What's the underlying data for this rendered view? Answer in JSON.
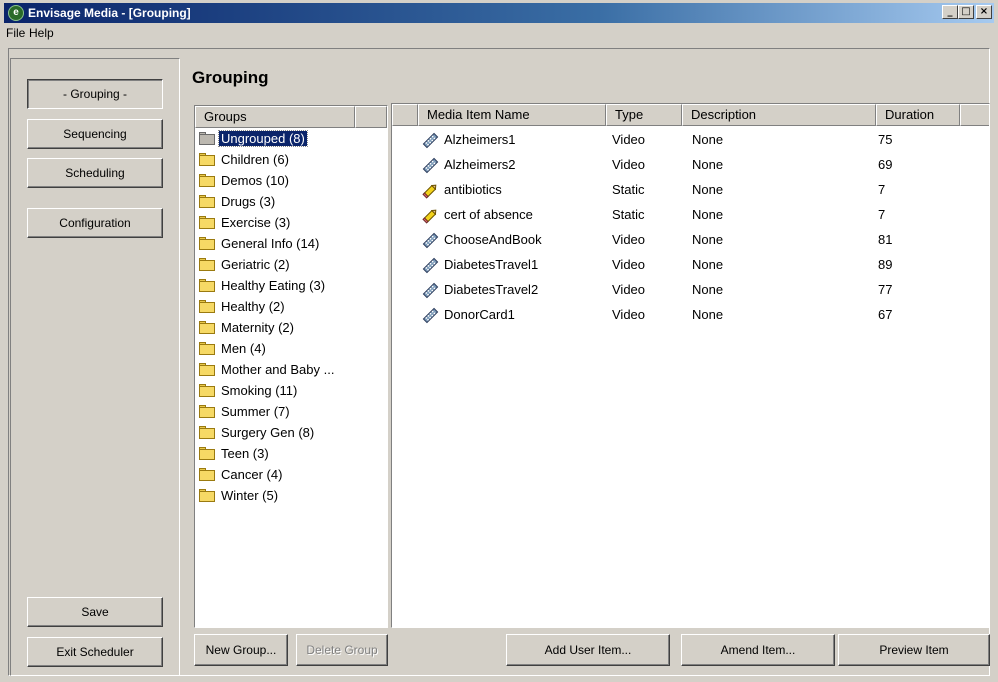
{
  "window": {
    "title": "Envisage Media - [Grouping]",
    "buttons": [
      "_",
      "□",
      "×"
    ]
  },
  "menu": [
    "File",
    "Help"
  ],
  "sidebar": {
    "nav": [
      {
        "label": "- Grouping -",
        "active": true
      },
      {
        "label": "Sequencing"
      },
      {
        "label": "Scheduling"
      },
      {
        "label": "Configuration"
      }
    ],
    "save_label": "Save",
    "exit_label": "Exit Scheduler"
  },
  "page": {
    "title": "Grouping"
  },
  "groups": {
    "header": "Groups",
    "items": [
      {
        "label": "Ungrouped (8)",
        "selected": true
      },
      {
        "label": "Children (6)"
      },
      {
        "label": "Demos (10)"
      },
      {
        "label": "Drugs (3)"
      },
      {
        "label": "Exercise (3)"
      },
      {
        "label": "General Info (14)"
      },
      {
        "label": "Geriatric (2)"
      },
      {
        "label": "Healthy Eating (3)"
      },
      {
        "label": "Healthy (2)"
      },
      {
        "label": "Maternity (2)"
      },
      {
        "label": "Men (4)"
      },
      {
        "label": "Mother and Baby ..."
      },
      {
        "label": "Smoking (11)"
      },
      {
        "label": "Summer (7)"
      },
      {
        "label": "Surgery Gen (8)"
      },
      {
        "label": "Teen (3)"
      },
      {
        "label": "Cancer (4)"
      },
      {
        "label": "Winter (5)"
      }
    ],
    "new_label": "New Group...",
    "delete_label": "Delete Group"
  },
  "media": {
    "columns": [
      "Media Item Name",
      "Type",
      "Description",
      "Duration"
    ],
    "rows": [
      {
        "icon": "video-icon",
        "name": "Alzheimers1",
        "type": "Video",
        "description": "None",
        "duration": "75"
      },
      {
        "icon": "video-icon",
        "name": "Alzheimers2",
        "type": "Video",
        "description": "None",
        "duration": "69"
      },
      {
        "icon": "static-icon",
        "name": "antibiotics",
        "type": "Static",
        "description": "None",
        "duration": "7"
      },
      {
        "icon": "static-icon",
        "name": "cert of absence",
        "type": "Static",
        "description": "None",
        "duration": "7"
      },
      {
        "icon": "video-icon",
        "name": "ChooseAndBook",
        "type": "Video",
        "description": "None",
        "duration": "81"
      },
      {
        "icon": "video-icon",
        "name": "DiabetesTravel1",
        "type": "Video",
        "description": "None",
        "duration": "89"
      },
      {
        "icon": "video-icon",
        "name": "DiabetesTravel2",
        "type": "Video",
        "description": "None",
        "duration": "77"
      },
      {
        "icon": "video-icon",
        "name": "DonorCard1",
        "type": "Video",
        "description": "None",
        "duration": "67"
      }
    ],
    "add_label": "Add User Item...",
    "amend_label": "Amend Item...",
    "preview_label": "Preview Item"
  }
}
